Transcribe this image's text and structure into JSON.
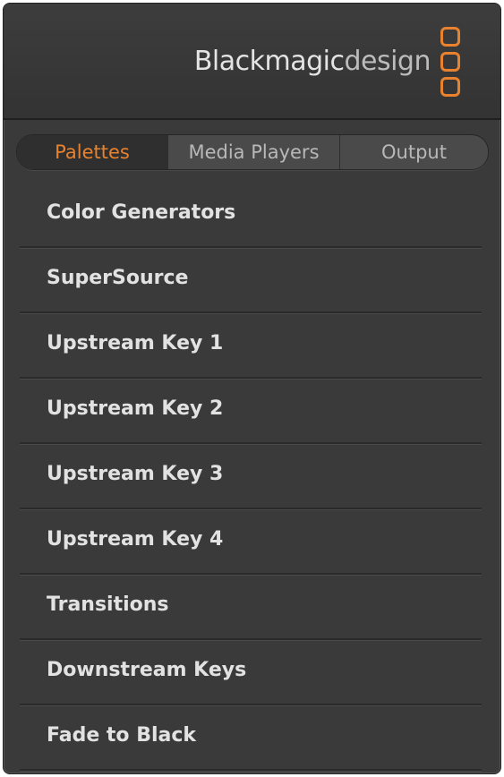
{
  "brand": {
    "name_bold": "Blackmagic",
    "name_light": "design",
    "accent_color": "#e8822e"
  },
  "tabs": [
    {
      "label": "Palettes",
      "active": true
    },
    {
      "label": "Media Players",
      "active": false
    },
    {
      "label": "Output",
      "active": false
    }
  ],
  "palettes": [
    {
      "label": "Color Generators"
    },
    {
      "label": "SuperSource"
    },
    {
      "label": "Upstream Key 1"
    },
    {
      "label": "Upstream Key 2"
    },
    {
      "label": "Upstream Key 3"
    },
    {
      "label": "Upstream Key 4"
    },
    {
      "label": "Transitions"
    },
    {
      "label": "Downstream Keys"
    },
    {
      "label": "Fade to Black"
    }
  ]
}
